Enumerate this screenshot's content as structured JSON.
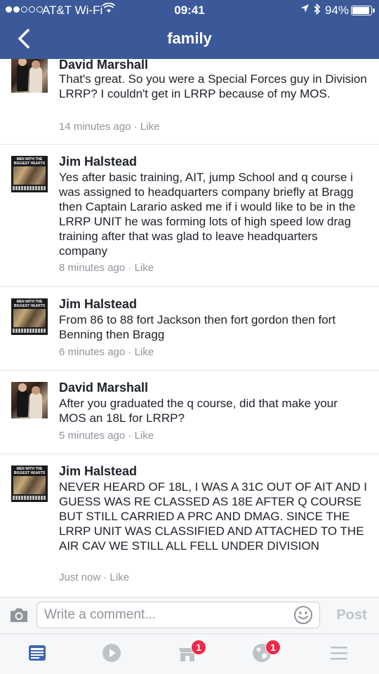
{
  "status_bar": {
    "carrier": "AT&T Wi-Fi",
    "time": "09:41",
    "battery": "94%",
    "battery_level": 0.94
  },
  "nav": {
    "title": "family",
    "back_icon": "chevron-left-icon"
  },
  "comments": [
    {
      "author": "David Marshall",
      "text": "That's great. So you were a Special Forces guy in Division LRRP?  I couldn't get in LRRP because of my MOS.",
      "time": "14 minutes ago",
      "like_label": "Like"
    },
    {
      "author": "Jim Halstead",
      "text": "Yes after basic training, AIT, jump School and q course i was assigned to headquarters company briefly at Bragg then Captain Larario asked me if i would like to be in the LRRP UNIT he was forming lots of high speed low drag training after that was glad to leave headquarters company",
      "time": "8 minutes ago",
      "like_label": "Like"
    },
    {
      "author": "Jim Halstead",
      "text": "From 86 to 88 fort Jackson then fort gordon then fort Benning then Bragg",
      "time": "6 minutes ago",
      "like_label": "Like"
    },
    {
      "author": "David Marshall",
      "text": "After you graduated the q course, did that make your MOS an 18L for LRRP?",
      "time": "5 minutes ago",
      "like_label": "Like"
    },
    {
      "author": "Jim Halstead",
      "text": "NEVER HEARD OF 18L, I WAS A 31C OUT OF AIT AND I GUESS WAS RE CLASSED AS 18E AFTER Q COURSE   BUT STILL CARRIED A PRC AND DMAG. SINCE THE LRRP UNIT WAS CLASSIFIED  AND ATTACHED TO THE AIR CAV WE STILL ALL FELL UNDER DIVISION",
      "time": "Just now",
      "like_label": "Like"
    }
  ],
  "avatar_text": {
    "jim_top": "MEN WITH THE BIGGEST HEARTS"
  },
  "composer": {
    "placeholder": "Write a comment...",
    "value": "",
    "post_label": "Post"
  },
  "tabbar": {
    "tabs": [
      "news-feed-icon",
      "video-icon",
      "marketplace-icon",
      "notifications-globe-icon",
      "menu-icon"
    ],
    "marketplace_badge": "1",
    "notifications_badge": "1"
  },
  "colors": {
    "brand": "#3b5998",
    "active_tab": "#4267b2",
    "inactive_tab": "#bec3c9",
    "badge": "#f02849",
    "meta_text": "#90949c"
  }
}
